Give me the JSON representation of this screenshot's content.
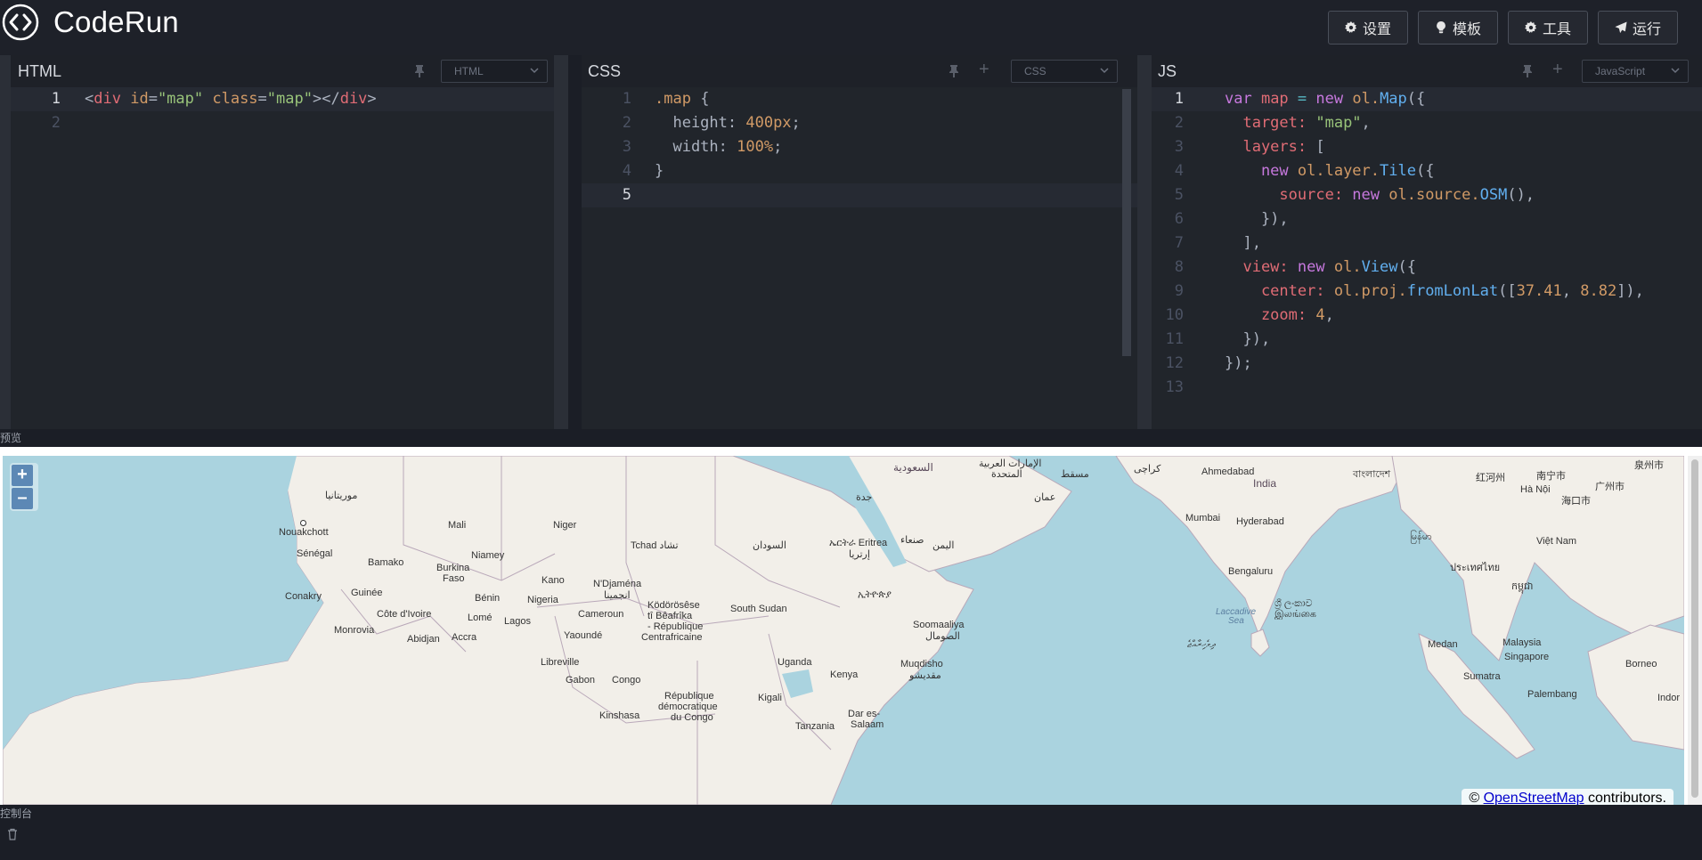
{
  "app": {
    "name": "CodeRun"
  },
  "toolbar": {
    "settings": "设置",
    "templates": "模板",
    "tools": "工具",
    "run": "运行"
  },
  "panels": {
    "html": {
      "title": "HTML",
      "language": "HTML",
      "lines": [
        "1",
        "2"
      ]
    },
    "css": {
      "title": "CSS",
      "language": "CSS",
      "lines": [
        "1",
        "2",
        "3",
        "4",
        "5"
      ]
    },
    "js": {
      "title": "JS",
      "language": "JavaScript",
      "lines": [
        "1",
        "2",
        "3",
        "4",
        "5",
        "6",
        "7",
        "8",
        "9",
        "10",
        "11",
        "12",
        "13"
      ]
    }
  },
  "code": {
    "html": {
      "l1_open": "<",
      "l1_tag": "div",
      "l1_attr1": " id",
      "l1_eq1": "=",
      "l1_val1": "\"map\"",
      "l1_attr2": " class",
      "l1_eq2": "=",
      "l1_val2": "\"map\"",
      "l1_close": "></",
      "l1_tag2": "div",
      "l1_end": ">"
    },
    "css": {
      "l1_sel": ".map",
      "l1_brace": " {",
      "l2_prop": "  height: ",
      "l2_val": "400px",
      "l2_semi": ";",
      "l3_prop": "  width: ",
      "l3_val": "100%",
      "l3_semi": ";",
      "l4": "}"
    },
    "js": {
      "l1_var": "var",
      "l1_name": " map",
      "l1_eq": " = ",
      "l1_new": "new",
      "l1_ns": " ol.",
      "l1_cls": "Map",
      "l1_end": "({",
      "l2_key": "  target: ",
      "l2_val": "\"map\"",
      "l2_end": ",",
      "l3_key": "  layers: ",
      "l3_end": "[",
      "l4_new": "    new",
      "l4_ns": " ol.layer.",
      "l4_cls": "Tile",
      "l4_end": "({",
      "l5_key": "      source: ",
      "l5_new": "new",
      "l5_ns": " ol.source.",
      "l5_cls": "OSM",
      "l5_end": "(),",
      "l6": "    }),",
      "l7": "  ],",
      "l8_key": "  view: ",
      "l8_new": "new",
      "l8_ns": " ol.",
      "l8_cls": "View",
      "l8_end": "({",
      "l9_key": "    center: ",
      "l9_ns": "ol.proj.",
      "l9_fn": "fromLonLat",
      "l9_open": "([",
      "l9_n1": "37.41",
      "l9_comma": ", ",
      "l9_n2": "8.82",
      "l9_close": "]),",
      "l10_key": "    zoom: ",
      "l10_val": "4",
      "l10_end": ",",
      "l11": "  }),",
      "l12": "});"
    }
  },
  "sections": {
    "preview": "预览",
    "console": "控制台"
  },
  "map": {
    "zoom_in": "+",
    "zoom_out": "–",
    "attribution_prefix": "© ",
    "attribution_link": "OpenStreetMap",
    "attribution_suffix": " contributors.",
    "labels": {
      "mauritania": "موريتانيا",
      "nouakchott": "Nouakchott",
      "mali": "Mali",
      "niger": "Niger",
      "senegal": "Sénégal",
      "bamako": "Bamako",
      "burkina": "Burkina",
      "faso": "Faso",
      "niamey": "Niamey",
      "tchad": "Tchad تشاد",
      "guinee": "Guinée",
      "conakry": "Conakry",
      "kano": "Kano",
      "ndjamena": "N'Djaména",
      "ndjamena_ar": "انجمينا",
      "benin": "Bénin",
      "nigeria": "Nigeria",
      "cote": "Côte d'Ivoire",
      "lome": "Lomé",
      "lagos": "Lagos",
      "monrovia": "Monrovia",
      "abidjan": "Abidjan",
      "accra": "Accra",
      "cameroun": "Cameroun",
      "yaounde": "Yaoundé",
      "kodoro": "Ködörösêse",
      "tibeafrika": "tî Bêafrîka",
      "rep": "- République",
      "centrafricaine": "Centrafricaine",
      "sudan": "السودان",
      "south_sudan": "South Sudan",
      "eritrea": "ኤርትራ Eritrea",
      "eritrea_ar": "إرتريا",
      "yemen": "اليمن",
      "sanaa": "صنعاء",
      "jeddah": "جدة",
      "saudi": "السعودية",
      "uae1": "الإمارات العربية",
      "uae2": "المتحدة",
      "muscat": "مسقط",
      "oman": "عمان",
      "karachi": "كراچی",
      "ethiopia": "ኢትዮጵያ",
      "somalia": "Soomaaliya",
      "somalia_ar": "الصومال",
      "mogadishu": "Muqdisho",
      "mogadishu_ar": "مقديشو",
      "kenya": "Kenya",
      "uganda": "Uganda",
      "kigali": "Kigali",
      "libreville": "Libreville",
      "gabon": "Gabon",
      "congo": "Congo",
      "rdc1": "République",
      "rdc2": "démocratique",
      "rdc3": "du Congo",
      "kinshasa": "Kinshasa",
      "tanzania": "Tanzania",
      "dar1": "Dar es-",
      "dar2": "Salaam",
      "ahmedabad": "Ahmedabad",
      "india": "India",
      "bangladesh": "বাংলাদেশ",
      "mumbai": "Mumbai",
      "hyderabad": "Hyderabad",
      "bengaluru": "Bengaluru",
      "lanka1": "ශ්‍රී ලංකාව",
      "lanka2": "இலங்கை",
      "laccadive": "Laccadive",
      "sea": "Sea",
      "maldives": "ދިވެހިރާއްޖެ",
      "myanmar": "မြန်မာ",
      "thailand": "ประเทศไทย",
      "cambodia": "កម្ពុជា",
      "vietnam": "Việt Nam",
      "hanoi": "Hà Nội",
      "hainan": "海口市",
      "nanning": "南宁市",
      "guangzhou": "广州市",
      "honghe": "红河州",
      "quanzhou": "泉州市",
      "medan": "Medan",
      "malaysia": "Malaysia",
      "singapore": "Singapore",
      "sumatra": "Sumatra",
      "palembang": "Palembang",
      "borneo": "Borneo",
      "indo": "Indor"
    }
  }
}
